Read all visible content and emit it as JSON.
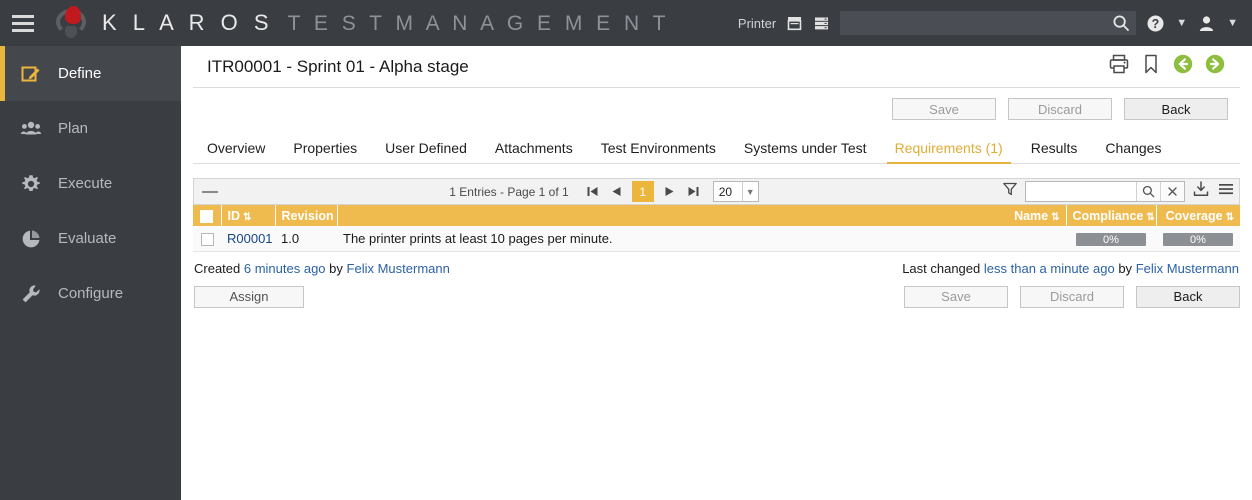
{
  "header": {
    "menu_icon": "hamburger-icon",
    "logo_icon": "klaros-logo-icon",
    "brand_primary": "K L A R O S",
    "brand_secondary": "T E S T   M A N A G E M E N T",
    "printer_label": "Printer",
    "printer_icon": "printer-device-icon",
    "server_icon": "server-rack-icon",
    "search_value": "",
    "search_placeholder": "",
    "search_icon": "search-icon",
    "help_icon": "help-circle-icon",
    "help_chevron": "chevron-down-icon",
    "user_icon": "user-icon",
    "user_chevron": "chevron-down-icon"
  },
  "sidebar": {
    "items": [
      {
        "label": "Define",
        "icon": "edit-pencil-icon",
        "active": true
      },
      {
        "label": "Plan",
        "icon": "users-group-icon",
        "active": false
      },
      {
        "label": "Execute",
        "icon": "gear-icon",
        "active": false
      },
      {
        "label": "Evaluate",
        "icon": "pie-chart-icon",
        "active": false
      },
      {
        "label": "Configure",
        "icon": "wrench-icon",
        "active": false
      }
    ]
  },
  "page": {
    "title": "ITR00001 - Sprint 01 - Alpha stage",
    "title_icons": [
      {
        "name": "print-icon"
      },
      {
        "name": "bookmark-icon"
      },
      {
        "name": "back-arrow-circle-icon"
      },
      {
        "name": "forward-arrow-circle-icon"
      }
    ]
  },
  "actions": {
    "save_label": "Save",
    "discard_label": "Discard",
    "back_label": "Back",
    "assign_label": "Assign"
  },
  "tabs": [
    {
      "label": "Overview",
      "active": false
    },
    {
      "label": "Properties",
      "active": false
    },
    {
      "label": "User Defined",
      "active": false
    },
    {
      "label": "Attachments",
      "active": false
    },
    {
      "label": "Test Environments",
      "active": false
    },
    {
      "label": "Systems under Test",
      "active": false
    },
    {
      "label": "Requirements (1)",
      "active": true
    },
    {
      "label": "Results",
      "active": false
    },
    {
      "label": "Changes",
      "active": false
    }
  ],
  "grid_toolbar": {
    "collapse_icon": "collapse-minus-icon",
    "entries_text": "1 Entries - Page 1 of 1",
    "first_page_icon": "first-page-icon",
    "prev_page_icon": "prev-page-icon",
    "current_page": "1",
    "next_page_icon": "next-page-icon",
    "last_page_icon": "last-page-icon",
    "page_size": "20",
    "page_size_chevron": "chevron-down-icon",
    "filter_icon": "filter-funnel-icon",
    "filter_value": "",
    "filter_placeholder": "",
    "filter_search_icon": "search-icon",
    "filter_clear_icon": "clear-x-icon",
    "export_icon": "export-download-icon",
    "menu_icon": "list-menu-icon"
  },
  "table": {
    "columns": [
      {
        "key": "check",
        "label": "",
        "sortable": false
      },
      {
        "key": "id",
        "label": "ID",
        "sortable": true
      },
      {
        "key": "revision",
        "label": "Revision",
        "sortable": false
      },
      {
        "key": "name",
        "label": "Name",
        "sortable": true
      },
      {
        "key": "compliance",
        "label": "Compliance",
        "sortable": true
      },
      {
        "key": "coverage",
        "label": "Coverage",
        "sortable": true
      }
    ],
    "rows": [
      {
        "id": "R00001",
        "revision": "1.0",
        "name": "The printer prints at least 10 pages per minute.",
        "compliance": "0%",
        "coverage": "0%",
        "checked": false
      }
    ]
  },
  "info": {
    "created_prefix": "Created",
    "created_time": "6 minutes ago",
    "created_by_word": "by",
    "created_user": "Felix Mustermann",
    "changed_prefix": "Last changed",
    "changed_time": "less than a minute ago",
    "changed_by_word": "by",
    "changed_user": "Felix Mustermann"
  },
  "colors": {
    "accent_amber": "#e8b63c",
    "header_amber": "#efbb4f",
    "dark_chrome": "#3a3d42",
    "sidebar_active": "#44474c",
    "link_blue": "#2a62a8",
    "progress_gray": "#8c8f93",
    "arrow_green": "#84b63c"
  }
}
